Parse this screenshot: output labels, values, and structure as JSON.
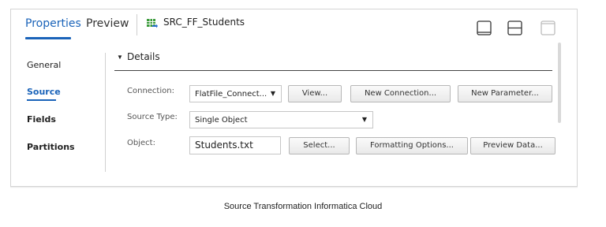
{
  "tabs": {
    "properties": "Properties",
    "preview": "Preview"
  },
  "object_title": "SRC_FF_Students",
  "sidebar": {
    "general": "General",
    "source": "Source",
    "fields": "Fields",
    "partitions": "Partitions"
  },
  "details": {
    "title": "Details",
    "connection_label": "Connection:",
    "connection_value": "FlatFile_Connect...",
    "view_button": "View...",
    "new_connection_button": "New Connection...",
    "new_parameter_button": "New Parameter...",
    "source_type_label": "Source Type:",
    "source_type_value": "Single Object",
    "object_label": "Object:",
    "object_value": "Students.txt",
    "select_button": "Select...",
    "formatting_button": "Formatting Options...",
    "preview_button": "Preview Data..."
  },
  "caption": "Source Transformation Informatica Cloud",
  "icons": [
    "table-icon",
    "layout-bottom-icon",
    "layout-split-icon",
    "layout-full-icon",
    "dropdown-arrow-icon",
    "caret-down-icon"
  ],
  "colors": {
    "accent": "#1a63b9",
    "icon_green": "#3a9a3a",
    "icon_blue": "#2a6fcf"
  }
}
